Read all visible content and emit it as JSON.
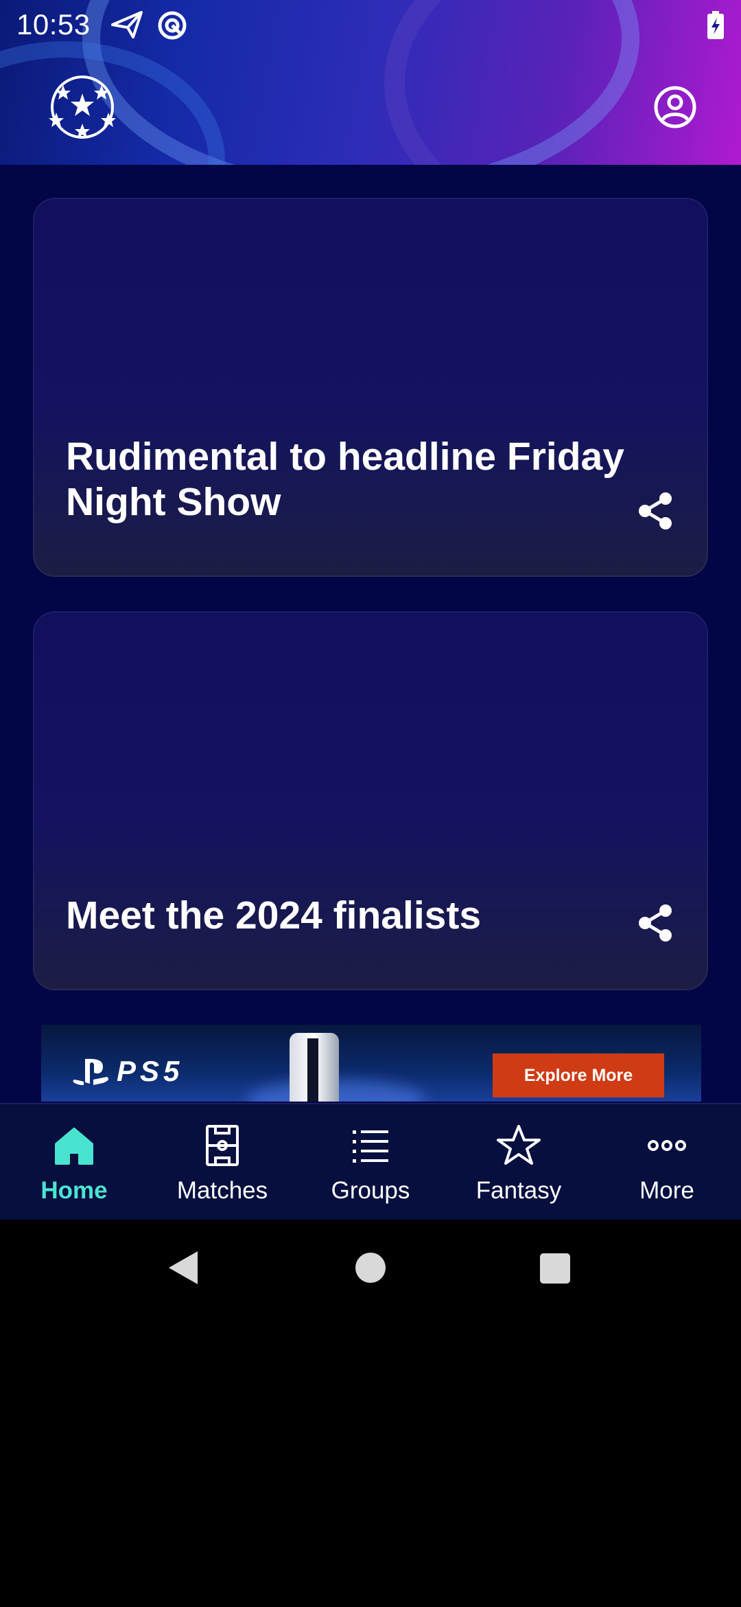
{
  "status_bar": {
    "time": "10:53",
    "icons": [
      "send-icon",
      "sync-icon",
      "battery-charging-icon"
    ]
  },
  "header": {
    "logo": "starball-logo",
    "profile_icon": "account-circle-icon"
  },
  "cards": [
    {
      "title": "Rudimental to headline Friday Night Show",
      "share_icon": "share-icon"
    },
    {
      "title": "Meet the 2024 finalists",
      "share_icon": "share-icon"
    }
  ],
  "ad": {
    "brand": "PS5",
    "cta": "Explore More",
    "cta_color": "#cf3b15"
  },
  "bottom_nav": {
    "items": [
      {
        "label": "Home",
        "icon": "home-icon",
        "active": true
      },
      {
        "label": "Matches",
        "icon": "pitch-icon",
        "active": false
      },
      {
        "label": "Groups",
        "icon": "list-icon",
        "active": false
      },
      {
        "label": "Fantasy",
        "icon": "star-icon",
        "active": false
      },
      {
        "label": "More",
        "icon": "more-dots-icon",
        "active": false
      }
    ],
    "active_color": "#49e4d0"
  },
  "system_nav": {
    "buttons": [
      "back-icon",
      "home-circle-icon",
      "recents-icon"
    ]
  }
}
